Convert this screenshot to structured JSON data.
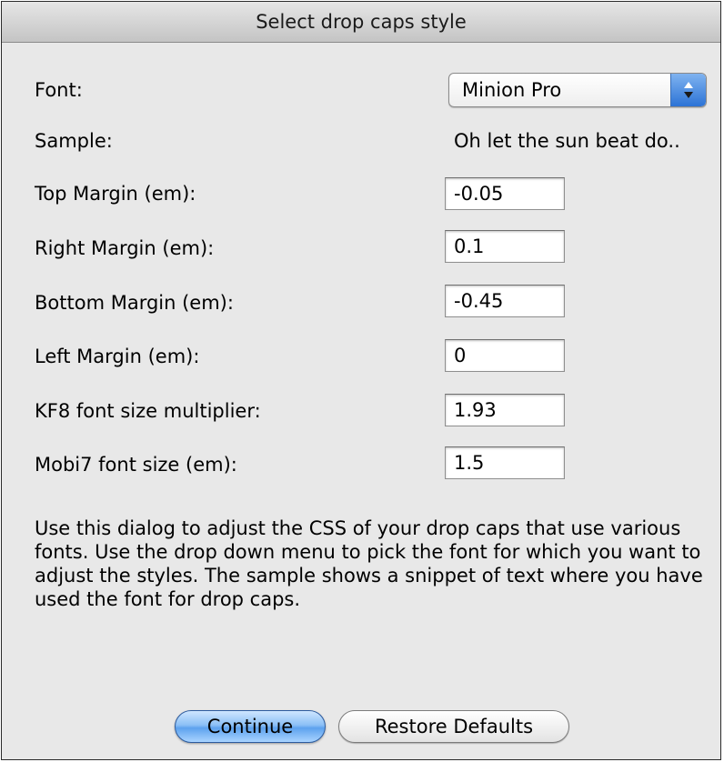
{
  "dialog": {
    "title": "Select drop caps style"
  },
  "font": {
    "label": "Font:",
    "selected": "Minion Pro"
  },
  "sample": {
    "label": "Sample:",
    "text": "Oh let the sun beat do.."
  },
  "fields": {
    "top_margin": {
      "label": "Top Margin (em):",
      "value": "-0.05"
    },
    "right_margin": {
      "label": "Right Margin (em):",
      "value": "0.1"
    },
    "bottom_margin": {
      "label": "Bottom Margin (em):",
      "value": "-0.45"
    },
    "left_margin": {
      "label": "Left Margin (em):",
      "value": "0"
    },
    "kf8_multiplier": {
      "label": "KF8 font size multiplier:",
      "value": "1.93"
    },
    "mobi7_size": {
      "label": "Mobi7 font size (em):",
      "value": "1.5"
    }
  },
  "help_text": "Use this dialog to adjust the CSS of your drop caps that use various fonts. Use the drop down menu to pick the font for which you want to adjust the styles. The sample shows a snippet of text where you have used the font for drop caps.",
  "buttons": {
    "continue_label": "Continue",
    "restore_label": "Restore Defaults"
  },
  "colors": {
    "accent": "#5da2ee",
    "dialog_background": "#e8e8e8"
  }
}
